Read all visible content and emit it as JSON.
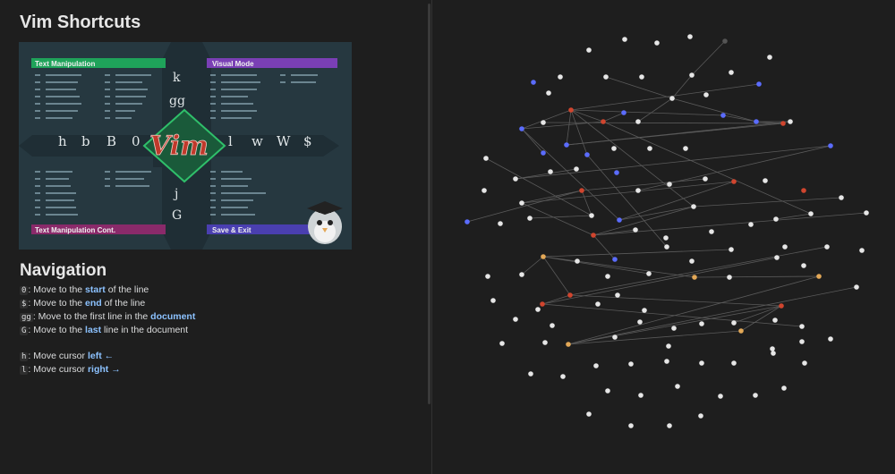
{
  "document": {
    "title": "Vim Shortcuts",
    "cheatsheet": {
      "panel_titles": {
        "top_left": "Text Manipulation",
        "top_right": "Visual Mode",
        "bottom_left": "Text Manipulation Cont.",
        "bottom_right": "Save & Exit"
      },
      "logo": "Vim",
      "horizontal_keys": [
        "h",
        "b",
        "B",
        "0",
        "l",
        "w",
        "W",
        "$"
      ],
      "vertical_keys": [
        "k",
        "gg",
        "j",
        "G"
      ]
    },
    "navigation": {
      "heading": "Navigation",
      "items": [
        {
          "key": "0",
          "before": ": Move to the ",
          "highlight": "start",
          "after": " of the line"
        },
        {
          "key": "$",
          "before": ": Move to the ",
          "highlight": "end",
          "after": " of the line"
        },
        {
          "key": "gg",
          "before": ": Move to the first line in the ",
          "highlight": "document",
          "after": ""
        },
        {
          "key": "G",
          "before": ": Move to the ",
          "highlight": "last",
          "after": " line in the document"
        },
        {
          "key": "h",
          "before": ": Move cursor ",
          "highlight": "left ←",
          "after": ""
        },
        {
          "key": "l",
          "before": ": Move cursor ",
          "highlight": "right →",
          "after": ""
        }
      ]
    }
  },
  "colors": {
    "background": "#1e1e1e",
    "accent_link": "#8cc2ff",
    "panel_green": "#1fa35a",
    "panel_purple": "#7a3fb5",
    "panel_magenta": "#8a2a6a",
    "panel_blue": "#4a3fb0",
    "logo_red": "#c0392b",
    "node_default": "#e6e6e6",
    "node_blue": "#5b6cff",
    "node_red": "#d0452e",
    "node_orange": "#e3a857",
    "node_dark": "#555555",
    "edge": "#5a5a5a"
  },
  "graph": {
    "nodes": [
      {
        "id": 0,
        "color": "white"
      },
      {
        "id": 1,
        "color": "white"
      },
      {
        "id": 2,
        "color": "white"
      },
      {
        "id": 3,
        "color": "dark"
      },
      {
        "id": 4,
        "color": "white"
      },
      {
        "id": 5,
        "color": "white"
      },
      {
        "id": 6,
        "color": "white"
      },
      {
        "id": 7,
        "color": "white"
      },
      {
        "id": 8,
        "color": "white"
      },
      {
        "id": 9,
        "color": "white"
      },
      {
        "id": 10,
        "color": "blue"
      },
      {
        "id": 11,
        "color": "white"
      },
      {
        "id": 12,
        "color": "blue"
      },
      {
        "id": 13,
        "color": "white"
      },
      {
        "id": 14,
        "color": "white"
      },
      {
        "id": 15,
        "color": "white"
      },
      {
        "id": 16,
        "color": "red"
      },
      {
        "id": 17,
        "color": "blue"
      },
      {
        "id": 18,
        "color": "red"
      },
      {
        "id": 19,
        "color": "white"
      },
      {
        "id": 20,
        "color": "blue"
      },
      {
        "id": 21,
        "color": "blue"
      },
      {
        "id": 22,
        "color": "white"
      },
      {
        "id": 23,
        "color": "red"
      },
      {
        "id": 24,
        "color": "blue"
      },
      {
        "id": 25,
        "color": "white"
      },
      {
        "id": 26,
        "color": "blue"
      },
      {
        "id": 27,
        "color": "blue"
      },
      {
        "id": 28,
        "color": "blue"
      },
      {
        "id": 29,
        "color": "white"
      },
      {
        "id": 30,
        "color": "white"
      },
      {
        "id": 31,
        "color": "white"
      },
      {
        "id": 32,
        "color": "blue"
      },
      {
        "id": 33,
        "color": "white"
      },
      {
        "id": 34,
        "color": "white"
      },
      {
        "id": 35,
        "color": "white"
      },
      {
        "id": 36,
        "color": "white"
      },
      {
        "id": 37,
        "color": "blue"
      },
      {
        "id": 38,
        "color": "white"
      },
      {
        "id": 39,
        "color": "white"
      },
      {
        "id": 40,
        "color": "white"
      },
      {
        "id": 41,
        "color": "red"
      },
      {
        "id": 42,
        "color": "white"
      },
      {
        "id": 43,
        "color": "red"
      },
      {
        "id": 44,
        "color": "white"
      },
      {
        "id": 45,
        "color": "white"
      },
      {
        "id": 46,
        "color": "red"
      },
      {
        "id": 47,
        "color": "white"
      },
      {
        "id": 48,
        "color": "blue"
      },
      {
        "id": 49,
        "color": "white"
      },
      {
        "id": 50,
        "color": "white"
      },
      {
        "id": 51,
        "color": "white"
      },
      {
        "id": 52,
        "color": "blue"
      },
      {
        "id": 53,
        "color": "white"
      },
      {
        "id": 54,
        "color": "white"
      },
      {
        "id": 55,
        "color": "red"
      },
      {
        "id": 56,
        "color": "white"
      },
      {
        "id": 57,
        "color": "white"
      },
      {
        "id": 58,
        "color": "white"
      },
      {
        "id": 59,
        "color": "white"
      },
      {
        "id": 60,
        "color": "white"
      },
      {
        "id": 61,
        "color": "white"
      },
      {
        "id": 62,
        "color": "white"
      },
      {
        "id": 63,
        "color": "white"
      },
      {
        "id": 64,
        "color": "white"
      },
      {
        "id": 65,
        "color": "white"
      },
      {
        "id": 66,
        "color": "white"
      },
      {
        "id": 67,
        "color": "white"
      },
      {
        "id": 68,
        "color": "orange"
      },
      {
        "id": 69,
        "color": "white"
      },
      {
        "id": 70,
        "color": "blue"
      },
      {
        "id": 71,
        "color": "white"
      },
      {
        "id": 72,
        "color": "white"
      },
      {
        "id": 73,
        "color": "white"
      },
      {
        "id": 74,
        "color": "white"
      },
      {
        "id": 75,
        "color": "orange"
      },
      {
        "id": 76,
        "color": "white"
      },
      {
        "id": 77,
        "color": "white"
      },
      {
        "id": 78,
        "color": "white"
      },
      {
        "id": 79,
        "color": "white"
      },
      {
        "id": 80,
        "color": "red"
      },
      {
        "id": 81,
        "color": "white"
      },
      {
        "id": 82,
        "color": "white"
      },
      {
        "id": 83,
        "color": "orange"
      },
      {
        "id": 84,
        "color": "red"
      },
      {
        "id": 85,
        "color": "white"
      },
      {
        "id": 86,
        "color": "white"
      },
      {
        "id": 87,
        "color": "white"
      },
      {
        "id": 88,
        "color": "red"
      },
      {
        "id": 89,
        "color": "white"
      },
      {
        "id": 90,
        "color": "white"
      },
      {
        "id": 91,
        "color": "white"
      },
      {
        "id": 92,
        "color": "white"
      },
      {
        "id": 93,
        "color": "white"
      },
      {
        "id": 94,
        "color": "white"
      },
      {
        "id": 95,
        "color": "white"
      },
      {
        "id": 96,
        "color": "white"
      },
      {
        "id": 97,
        "color": "white"
      },
      {
        "id": 98,
        "color": "orange"
      },
      {
        "id": 99,
        "color": "white"
      },
      {
        "id": 100,
        "color": "white"
      },
      {
        "id": 101,
        "color": "orange"
      },
      {
        "id": 102,
        "color": "white"
      },
      {
        "id": 103,
        "color": "white"
      },
      {
        "id": 104,
        "color": "white"
      },
      {
        "id": 105,
        "color": "white"
      },
      {
        "id": 106,
        "color": "white"
      },
      {
        "id": 107,
        "color": "white"
      },
      {
        "id": 108,
        "color": "white"
      },
      {
        "id": 109,
        "color": "white"
      },
      {
        "id": 110,
        "color": "white"
      },
      {
        "id": 111,
        "color": "white"
      },
      {
        "id": 112,
        "color": "white"
      },
      {
        "id": 113,
        "color": "white"
      },
      {
        "id": 114,
        "color": "white"
      },
      {
        "id": 115,
        "color": "white"
      },
      {
        "id": 116,
        "color": "white"
      },
      {
        "id": 117,
        "color": "white"
      },
      {
        "id": 118,
        "color": "white"
      },
      {
        "id": 119,
        "color": "white"
      },
      {
        "id": 120,
        "color": "white"
      },
      {
        "id": 121,
        "color": "white"
      },
      {
        "id": 122,
        "color": "white"
      },
      {
        "id": 123,
        "color": "white"
      },
      {
        "id": 124,
        "color": "white"
      }
    ],
    "edges": [
      [
        3,
        9
      ],
      [
        9,
        14
      ],
      [
        14,
        7
      ],
      [
        14,
        19
      ],
      [
        12,
        16
      ],
      [
        16,
        26
      ],
      [
        16,
        20
      ],
      [
        16,
        18
      ],
      [
        16,
        27
      ],
      [
        16,
        24
      ],
      [
        16,
        49
      ],
      [
        18,
        17
      ],
      [
        18,
        24
      ],
      [
        20,
        21
      ],
      [
        21,
        14
      ],
      [
        21,
        22
      ],
      [
        21,
        23
      ],
      [
        23,
        26
      ],
      [
        23,
        25
      ],
      [
        24,
        48
      ],
      [
        26,
        22
      ],
      [
        28,
        24
      ],
      [
        32,
        34
      ],
      [
        32,
        38
      ],
      [
        33,
        47
      ],
      [
        34,
        36
      ],
      [
        40,
        46
      ],
      [
        41,
        45
      ],
      [
        41,
        48
      ],
      [
        45,
        46
      ],
      [
        46,
        52
      ],
      [
        46,
        47
      ],
      [
        47,
        54
      ],
      [
        49,
        48
      ],
      [
        49,
        55
      ],
      [
        49,
        50
      ],
      [
        55,
        56
      ],
      [
        55,
        51
      ],
      [
        55,
        70
      ],
      [
        55,
        45
      ],
      [
        66,
        84
      ],
      [
        68,
        84
      ],
      [
        84,
        80
      ],
      [
        84,
        88
      ],
      [
        68,
        75
      ],
      [
        75,
        83
      ],
      [
        83,
        98
      ],
      [
        98,
        101
      ],
      [
        101,
        88
      ],
      [
        88,
        98
      ],
      [
        80,
        96
      ],
      [
        80,
        77
      ],
      [
        71,
        68
      ],
      [
        68,
        64
      ],
      [
        68,
        73
      ],
      [
        88,
        94
      ],
      [
        79,
        98
      ],
      [
        61,
        60
      ],
      [
        27,
        62
      ],
      [
        18,
        61
      ]
    ]
  }
}
